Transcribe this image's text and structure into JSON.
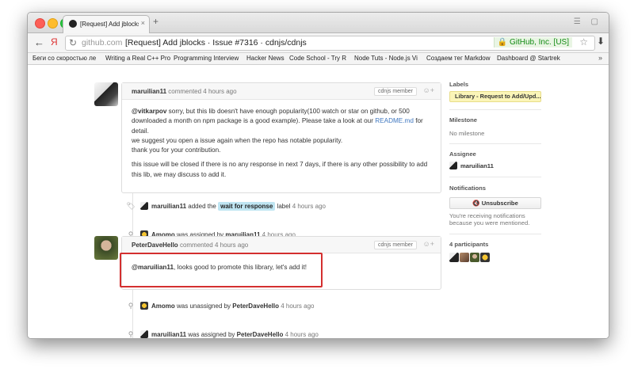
{
  "browser": {
    "tab_title": "[Request] Add jblocks · Issu",
    "url_host": "github.com",
    "url_title": "[Request] Add jblocks · Issue #7316 · cdnjs/cdnjs",
    "ev_cert": "GitHub, Inc. [US]",
    "new_tab": "+",
    "back": "←",
    "forward": "→",
    "yandex": "Я",
    "bookmarks": [
      "Беги со скоростью ле",
      "Writing a Real C++ Pro",
      "Programming Interview",
      "Hacker News",
      "Code School - Try R",
      "Node Tuts - Node.js Vi",
      "Создаем тег Markdow",
      "Dashboard @ Startrek"
    ],
    "bookmarks_more": "»"
  },
  "comments": [
    {
      "author": "maruilian11",
      "meta": "commented 4 hours ago",
      "badge": "cdnjs member",
      "mention": "@vitkarpov",
      "p1": " sorry, but this lib doesn't have enough popularity(100 watch or star on github, or 500 downloaded a month on npm package is a good example). Please take a look at our ",
      "link": "README.md",
      "p1_end": " for detail.",
      "p2": "we suggest you open a issue again when the repo has notable popularity.",
      "p3": "thank you for your contribution.",
      "p4": "this issue will be closed if there is no any response in next 7 days, if there is any other possibility to add this lib, we may discuss to add it."
    },
    {
      "author": "PeterDaveHello",
      "meta": "commented 4 hours ago",
      "badge": "cdnjs member",
      "mention": "@maruilian11",
      "text": ", looks good to promote this library, let's add it!"
    }
  ],
  "events": [
    {
      "actor": "maruilian11",
      "pre": "added the",
      "label": "wait for response",
      "post": "label",
      "time": "4 hours ago"
    },
    {
      "actor": "Amomo",
      "pre": "was assigned by",
      "by": "maruilian11",
      "time": "4 hours ago"
    },
    {
      "actor": "Amomo",
      "pre": "was unassigned by",
      "by": "PeterDaveHello",
      "time": "4 hours ago"
    },
    {
      "actor": "maruilian11",
      "pre": "was assigned by",
      "by": "PeterDaveHello",
      "time": "4 hours ago"
    }
  ],
  "sidebar": {
    "labels_heading": "Labels",
    "label_value": "Library - Request to Add/Upd...",
    "milestone_heading": "Milestone",
    "milestone_value": "No milestone",
    "assignee_heading": "Assignee",
    "assignee_value": "maruilian11",
    "notifications_heading": "Notifications",
    "unsubscribe": "Unsubscribe",
    "notif_text1": "You're receiving notifications",
    "notif_text2": "because you were mentioned.",
    "participants_heading": "4 participants"
  },
  "colors": {
    "highlight_border": "#d42f2f",
    "label_chip": "#fbf5b8",
    "wait_label": "#bfe5f2",
    "link": "#4078c0"
  }
}
